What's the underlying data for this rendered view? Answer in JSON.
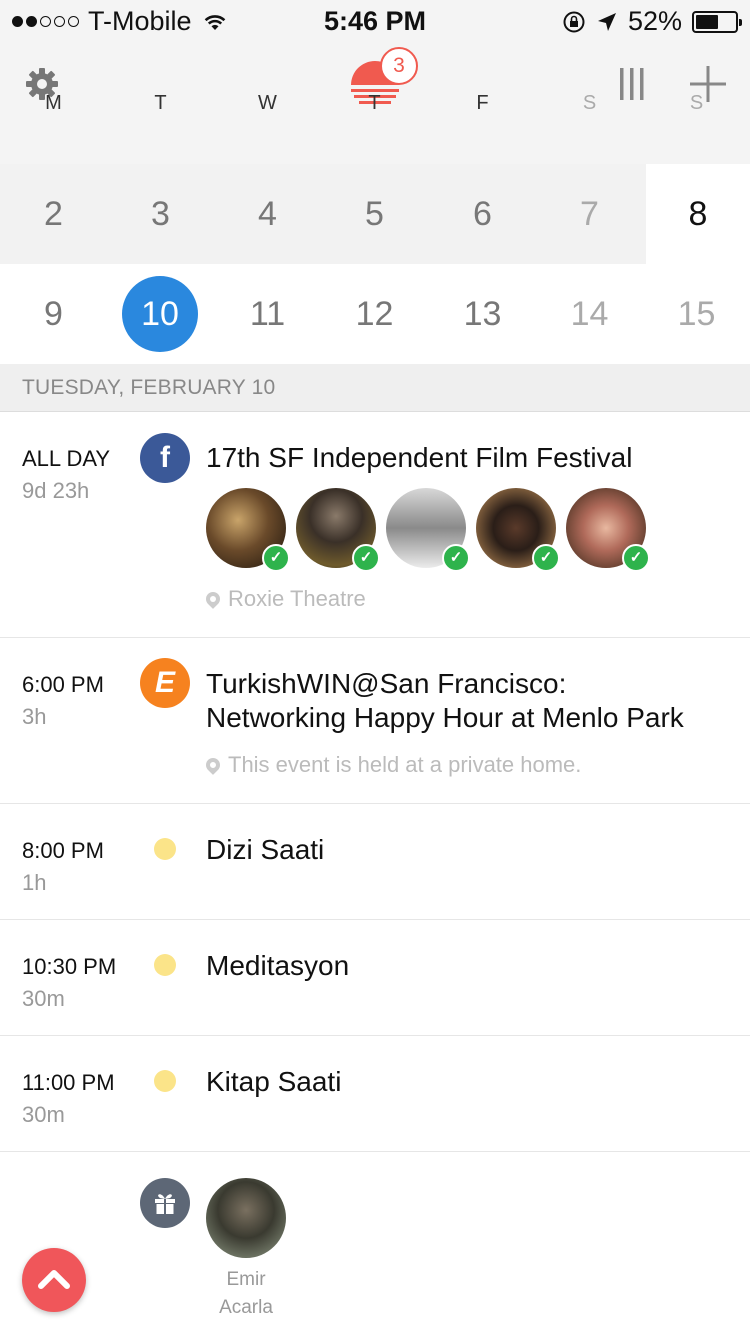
{
  "status_bar": {
    "carrier": "T-Mobile",
    "time": "5:46 PM",
    "battery": "52%"
  },
  "header": {
    "notification_count": "3",
    "weekdays": [
      "M",
      "T",
      "W",
      "T",
      "F",
      "S",
      "S"
    ]
  },
  "calendar": {
    "week1": [
      "2",
      "3",
      "4",
      "5",
      "6",
      "7",
      "8"
    ],
    "week2": [
      "9",
      "10",
      "11",
      "12",
      "13",
      "14",
      "15"
    ],
    "selected_day": "10",
    "today": "8"
  },
  "section_header": "TUESDAY, FEBRUARY 10",
  "events": [
    {
      "time": "ALL DAY",
      "duration": "9d 23h",
      "title": "17th SF Independent Film Festival",
      "source_icon": "facebook-icon",
      "location": "Roxie Theatre",
      "attendee_count": 5
    },
    {
      "time": "6:00 PM",
      "duration": "3h",
      "title_line1": "TurkishWIN@San Francisco:",
      "title_line2": "Networking Happy Hour at Menlo Park",
      "source_icon": "eventbrite-icon",
      "location": "This event is held at a private home."
    },
    {
      "time": "8:00 PM",
      "duration": "1h",
      "title": "Dizi Saati"
    },
    {
      "time": "10:30 PM",
      "duration": "30m",
      "title": "Meditasyon"
    },
    {
      "time": "11:00 PM",
      "duration": "30m",
      "title": "Kitap Saati"
    }
  ],
  "birthday": {
    "first_name": "Emir",
    "last_name": "Acarla"
  },
  "colors": {
    "accent_blue": "#2a88de",
    "brand_red": "#f05a4f",
    "facebook": "#3b5998",
    "eventbrite": "#f6821f",
    "calendar_dot": "#fbe489",
    "check_green": "#2eb34c"
  }
}
